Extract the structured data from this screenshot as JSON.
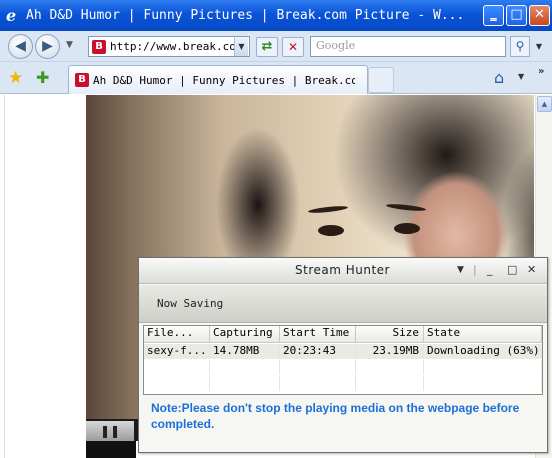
{
  "window": {
    "title": "Ah D&D Humor | Funny Pictures | Break.com Picture - W...",
    "min_label": "‗",
    "max_label": "□",
    "close_label": "✕"
  },
  "nav": {
    "back_glyph": "◀",
    "forward_glyph": "▶",
    "dropdown_glyph": "▼",
    "address": "http://www.break.com/",
    "favicon_letter": "B",
    "refresh_glyph": "⇄",
    "stop_glyph": "✕",
    "search_placeholder": "Google",
    "search_glyph": "⚲"
  },
  "tabs": {
    "favorites_glyph": "★",
    "add_favorite_glyph": "✚",
    "active_tab": "Ah D&D Humor | Funny Pictures | Break.com...",
    "home_glyph": "⌂",
    "more_glyph": "»"
  },
  "player": {
    "pause_glyph": "❚❚"
  },
  "scroll": {
    "up_glyph": "▲"
  },
  "stream_hunter": {
    "title": "Stream Hunter",
    "controls": {
      "dropdown": "▼",
      "separator": "|",
      "minimize": "_",
      "maximize": "□",
      "close": "✕"
    },
    "toolbar_label": "Now Saving",
    "columns": [
      "File...",
      "Capturing",
      "Start Time",
      "Size",
      "State"
    ],
    "rows": [
      {
        "file": "sexy-f...",
        "capturing": "14.78MB",
        "start_time": "20:23:43",
        "size": "23.19MB",
        "state": "Downloading (63%)"
      }
    ],
    "note": "Note:Please don't stop the playing media on the webpage before completed."
  },
  "colors": {
    "titlebar": "#0a54d8",
    "note_text": "#1d6fd6",
    "chrome_bg": "#dbe6f5"
  }
}
